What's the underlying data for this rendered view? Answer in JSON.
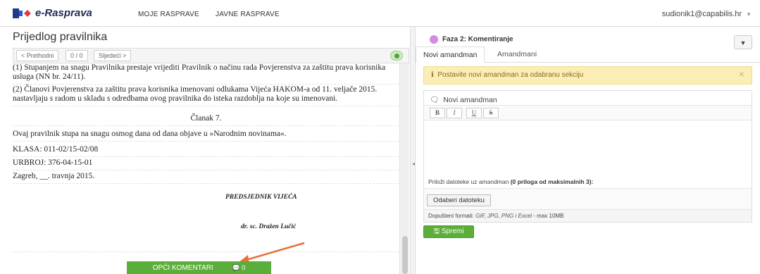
{
  "app": {
    "logo_text": "e-Rasprava",
    "nav": [
      "MOJE RASPRAVE",
      "JAVNE RASPRAVE"
    ],
    "user": "sudionik1@capabilis.hr"
  },
  "left": {
    "title": "Prijedlog pravilnika",
    "toolbar": {
      "prev": "< Prethodni",
      "counter": "0 / 0",
      "next": "Sljedeći >"
    },
    "paragraphs": [
      "(1) Stupanjem na snagu Pravilnika prestaje vrijediti Pravilnik o načinu rada Povjerenstva za zaštitu prava korisnika usluga (NN br. 24/11).",
      "(2) Članovi Povjerenstva za zaštitu prava korisnika imenovani odlukama Vijeća HAKOM-a od 11. veljače 2015. nastavljaju s radom u skladu s odredbama ovog pravilnika do isteka razdoblja na koje su imenovani.",
      "Članak 7.",
      "Ovaj pravilnik stupa na snagu osmog dana od dana objave u »Narodnim novinama«.",
      "KLASA: 011-02/15-02/08",
      "URBROJ: 376-04-15-01",
      "Zagreb, __. travnja 2015."
    ],
    "signature_title": "PREDSJEDNIK VIJEĆA",
    "signature_name": "dr. sc. Dražen Lučić",
    "comments_button": "OPĆI KOMENTARI",
    "comments_count": "0"
  },
  "right": {
    "phase": "Faza 2: Komentiranje",
    "tabs": [
      "Novi amandman",
      "Amandmani"
    ],
    "alert": "Postavite novi amandman za odabranu sekciju",
    "amendment_heading": "Novi amandman",
    "editor_buttons": [
      "B",
      "I",
      "U",
      "S"
    ],
    "attach_prefix": "Priloži datoteke uz amandman",
    "attach_count": "(0 priloga od maksimalnih 3):",
    "choose_file": "Odaberi datoteku",
    "formats_prefix": "Dopušteni formati:",
    "formats_list": "GIF, JPG, PNG i Excel",
    "formats_suffix": "- max 10MB",
    "save_button": "Spremi"
  },
  "colors": {
    "green": "#5cae3a",
    "alert_bg": "#fbedb6",
    "phase_dot": "#d28be0",
    "arrow": "#e8703a"
  }
}
